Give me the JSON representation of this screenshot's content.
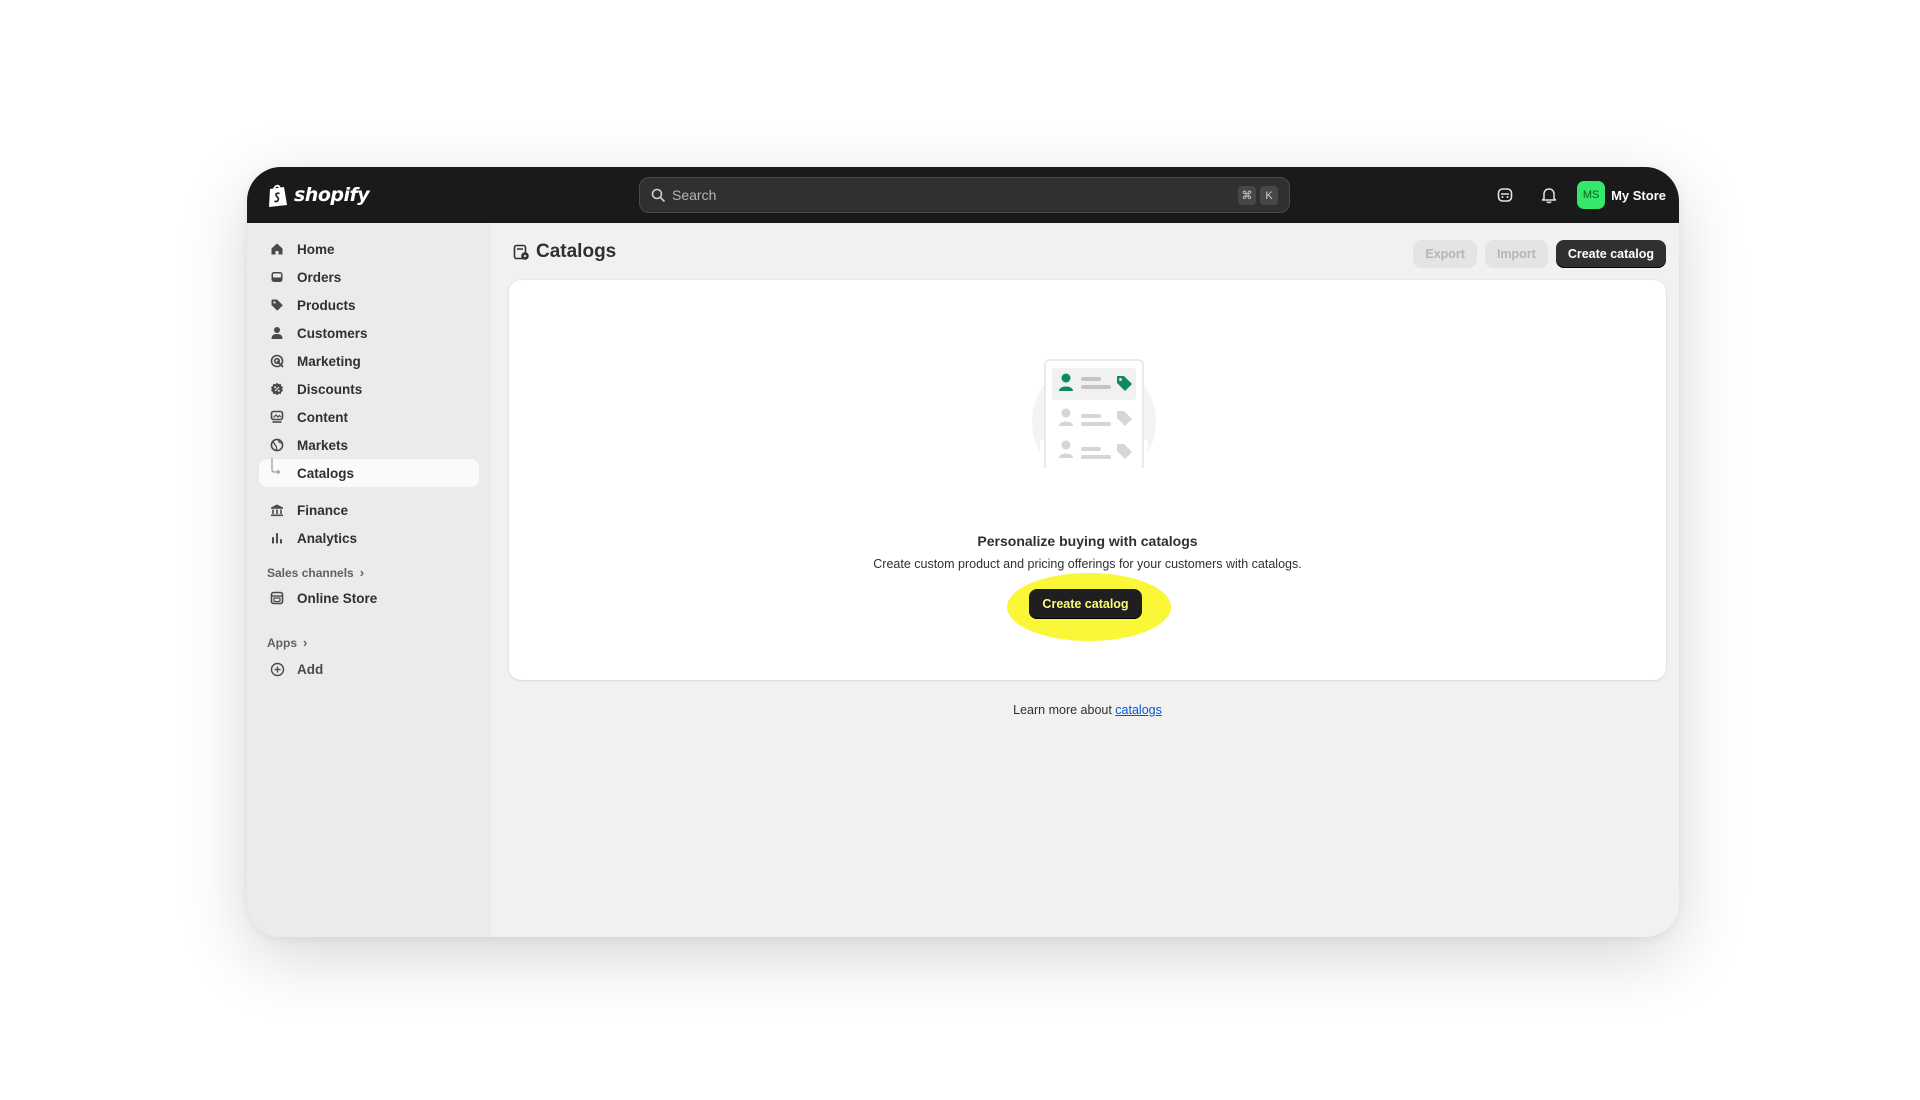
{
  "app": {
    "brand": "shopify",
    "store_name": "My Store",
    "avatar_initials": "MS",
    "avatar_color": "#36e86a",
    "accent_dark": "#303030",
    "highlight_color": "#f9f737"
  },
  "search": {
    "placeholder": "Search",
    "shortcut_keys": [
      "⌘",
      "K"
    ]
  },
  "sidebar": {
    "items": [
      {
        "label": "Home",
        "icon": "home-icon"
      },
      {
        "label": "Orders",
        "icon": "inbox-icon"
      },
      {
        "label": "Products",
        "icon": "tag-icon"
      },
      {
        "label": "Customers",
        "icon": "person-icon"
      },
      {
        "label": "Marketing",
        "icon": "target-icon"
      },
      {
        "label": "Discounts",
        "icon": "discount-icon"
      },
      {
        "label": "Content",
        "icon": "content-icon"
      },
      {
        "label": "Markets",
        "icon": "globe-icon"
      },
      {
        "label": "Catalogs",
        "icon": "sub-branch-icon",
        "active": true
      },
      {
        "label": "Finance",
        "icon": "bank-icon"
      },
      {
        "label": "Analytics",
        "icon": "bar-chart-icon"
      }
    ],
    "sales_channels_label": "Sales channels",
    "online_store_label": "Online Store",
    "apps_label": "Apps",
    "add_label": "Add"
  },
  "page": {
    "title": "Catalogs",
    "actions": {
      "export": "Export",
      "import": "Import",
      "create": "Create catalog"
    }
  },
  "empty_state": {
    "heading": "Personalize buying with catalogs",
    "description": "Create custom product and pricing offerings for your customers with catalogs.",
    "button_label": "Create catalog"
  },
  "footer": {
    "learn_prefix": "Learn more about ",
    "learn_link": "catalogs"
  }
}
